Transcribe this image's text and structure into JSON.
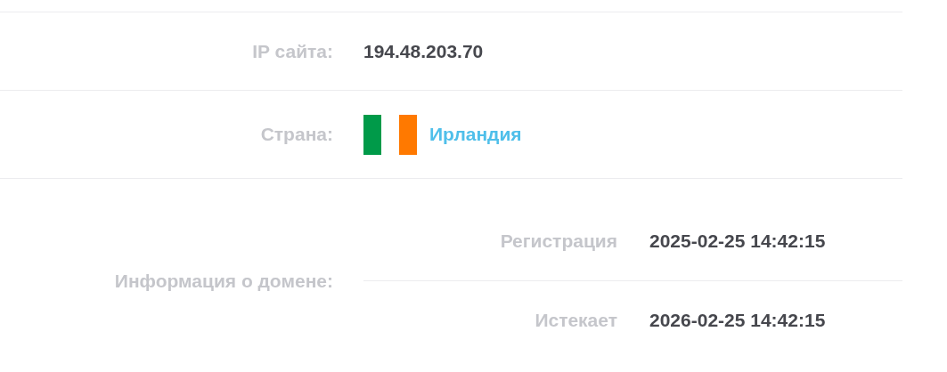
{
  "rows": [
    {
      "kind": "text",
      "label": "IP сайта:",
      "value": "194.48.203.70"
    },
    {
      "kind": "country",
      "label": "Страна:",
      "value": "Ирландия"
    },
    {
      "kind": "nested",
      "label": "Информация о домене:",
      "items": [
        {
          "label": "Регистрация",
          "value": "2025-02-25 14:42:15"
        },
        {
          "label": "Истекает",
          "value": "2026-02-25 14:42:15"
        }
      ]
    }
  ]
}
